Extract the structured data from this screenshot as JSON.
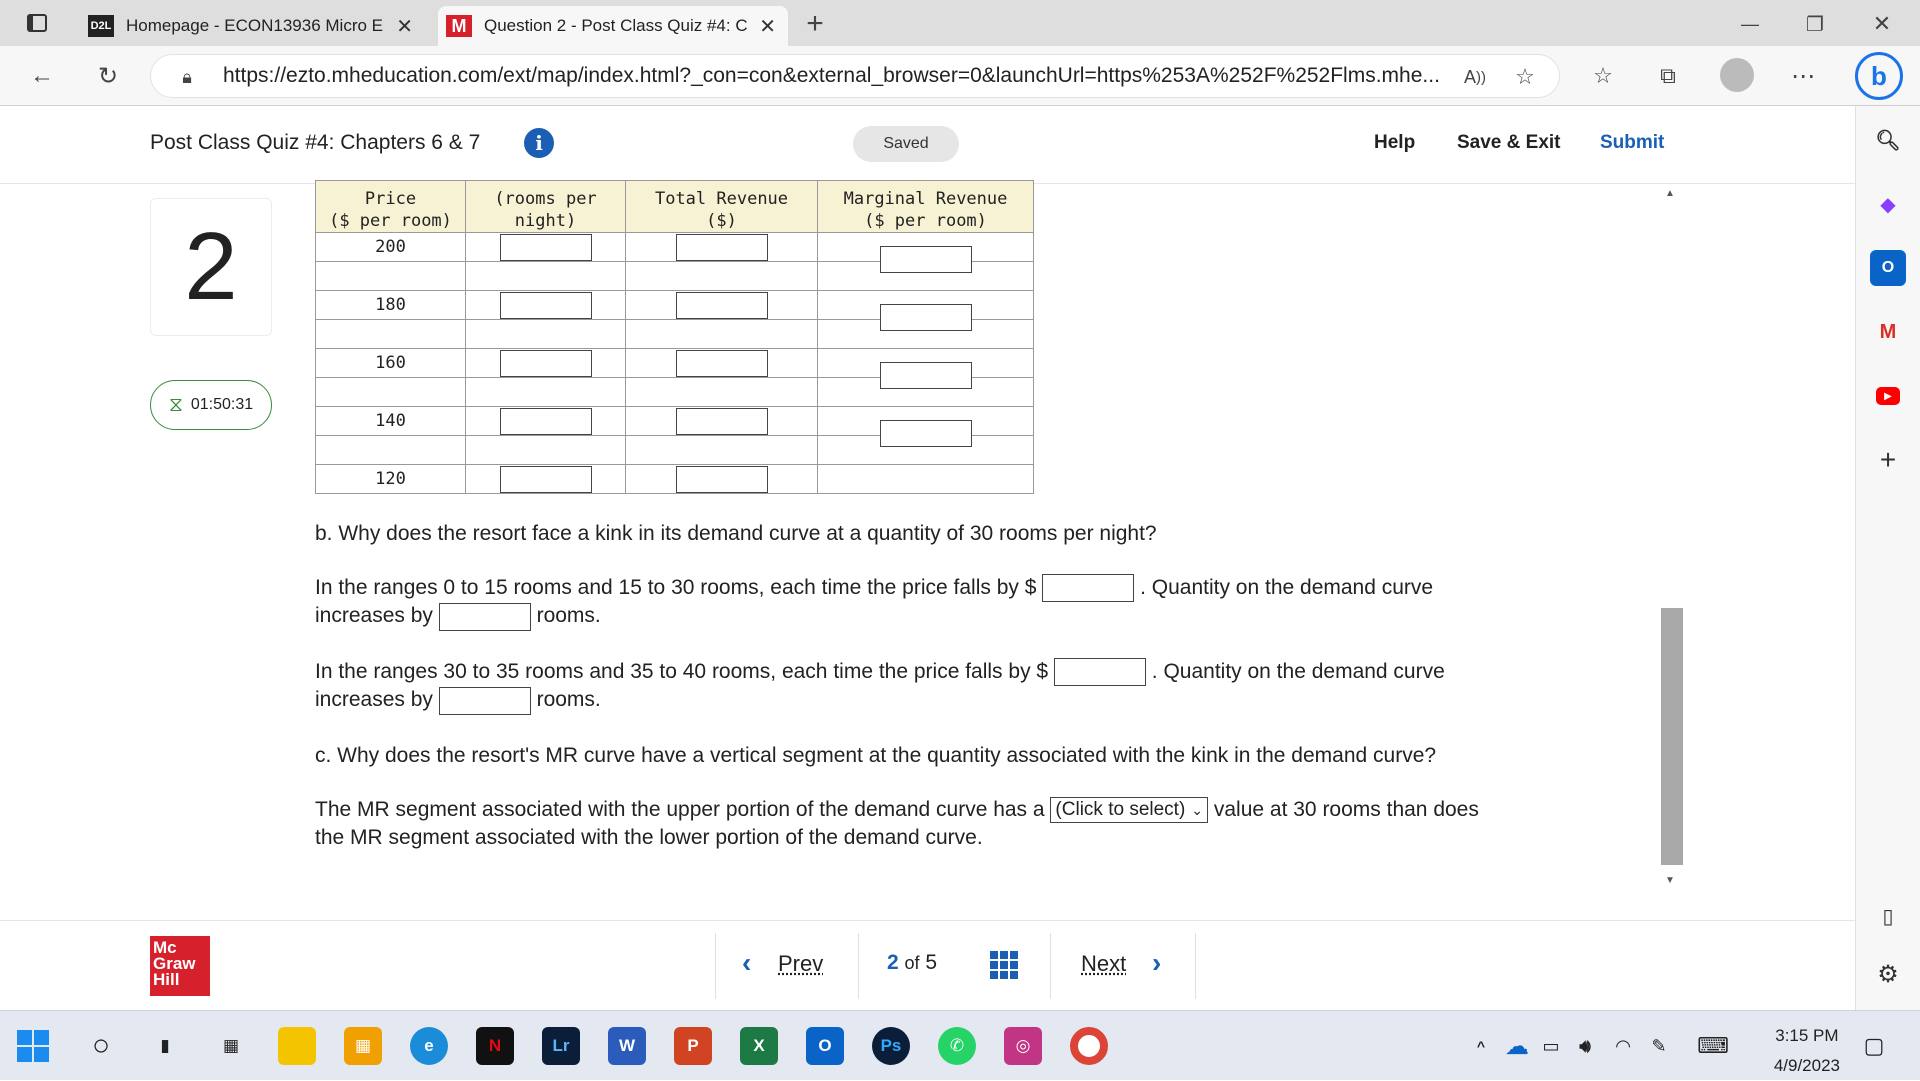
{
  "browser": {
    "tabs": [
      {
        "favicon": "D2L",
        "title": "Homepage - ECON13936 Micro E"
      },
      {
        "favicon": "M",
        "title": "Question 2 - Post Class Quiz #4: C"
      }
    ],
    "new_tab": "+",
    "url": "https://ezto.mheducation.com/ext/map/index.html?_con=con&external_browser=0&launchUrl=https%253A%252F%252Flms.mhe...",
    "window_controls": [
      "—",
      "❐",
      "✕"
    ]
  },
  "header": {
    "quiz_title": "Post Class Quiz #4: Chapters 6 & 7",
    "info": "i",
    "saved": "Saved",
    "help": "Help",
    "save_exit": "Save & Exit",
    "submit": "Submit"
  },
  "question": {
    "number": "2",
    "timer": "01:50:31"
  },
  "table": {
    "headers": [
      "Price ($ per room)",
      "(rooms per night)",
      "Total Revenue ($)",
      "Marginal Revenue ($ per room)"
    ],
    "header_lines": [
      [
        "Price",
        "($ per room)"
      ],
      [
        "(rooms per",
        "night)"
      ],
      [
        "Total Revenue",
        "($)"
      ],
      [
        "Marginal Revenue",
        "($ per room)"
      ]
    ],
    "prices": [
      "200",
      "180",
      "160",
      "140",
      "120"
    ]
  },
  "part_b": {
    "question": "b. Why does the resort face a kink in its demand curve at a quantity of 30 rooms per night?",
    "line1_a": "In the ranges 0 to 15 rooms and 15 to 30 rooms, each time the price falls by $",
    "line1_b": ". Quantity on the demand curve",
    "line1_c": "increases by",
    "line1_d": "rooms.",
    "line2_a": "In the ranges 30 to 35 rooms and 35 to 40 rooms, each time the price falls by $",
    "line2_b": ". Quantity on the demand curve",
    "line2_c": "increases by",
    "line2_d": "rooms."
  },
  "part_c": {
    "question": "c. Why does the resort's MR curve have a vertical segment at the quantity associated with the kink in the demand curve?",
    "text_a": "The MR segment associated with the upper portion of the demand curve has a",
    "select_value": "(Click to select)",
    "text_b": "value at 30 rooms than does",
    "text_c": "the MR segment associated with the lower portion of the demand curve."
  },
  "footer": {
    "logo": [
      "Mc",
      "Graw",
      "Hill"
    ],
    "prev": "Prev",
    "page_current": "2",
    "page_of": "of",
    "page_total": "5",
    "next": "Next"
  },
  "taskbar": {
    "time": "3:15 PM",
    "date": "4/9/2023"
  },
  "colors": {
    "accent_blue": "#1a5fb4",
    "table_header": "#f7f2d4",
    "timer_border": "#3c8a3c",
    "logo_red": "#d6202b"
  }
}
